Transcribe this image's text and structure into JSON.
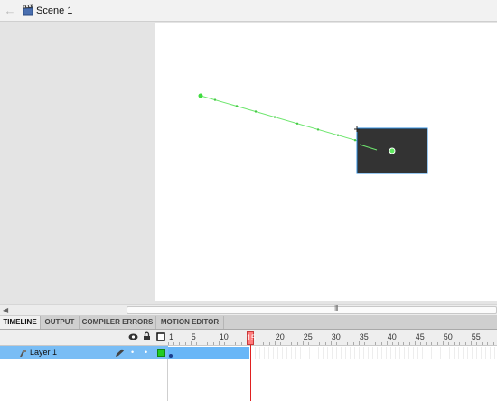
{
  "editbar": {
    "back_icon": "back-arrow-icon",
    "scene_icon": "clapperboard-icon",
    "scene_name": "Scene 1"
  },
  "stage": {
    "background": "#ffffff",
    "motion_path_color": "#6ee66e",
    "rectangle_color": "#333333",
    "rectangle_border": "#2f8fe0"
  },
  "scrollbar": {
    "left_icon": "scroll-left-arrow-icon",
    "grip": "III"
  },
  "tabs": [
    {
      "label": "TIMELINE",
      "active": true
    },
    {
      "label": "OUTPUT",
      "active": false
    },
    {
      "label": "COMPILER ERRORS",
      "active": false
    },
    {
      "label": "MOTION EDITOR",
      "active": false
    }
  ],
  "timeline": {
    "header_icons": [
      "eye-icon",
      "lock-icon",
      "outline-icon"
    ],
    "ruler": [
      "1",
      "5",
      "10",
      "15",
      "20",
      "25",
      "30",
      "35",
      "40",
      "45",
      "50",
      "55"
    ],
    "current_frame": "15",
    "layers": [
      {
        "name": "Layer 1",
        "icon": "layer-icon",
        "edit_icon": "pencil-icon",
        "selected": true,
        "outline_color": "#22cc22"
      }
    ]
  }
}
